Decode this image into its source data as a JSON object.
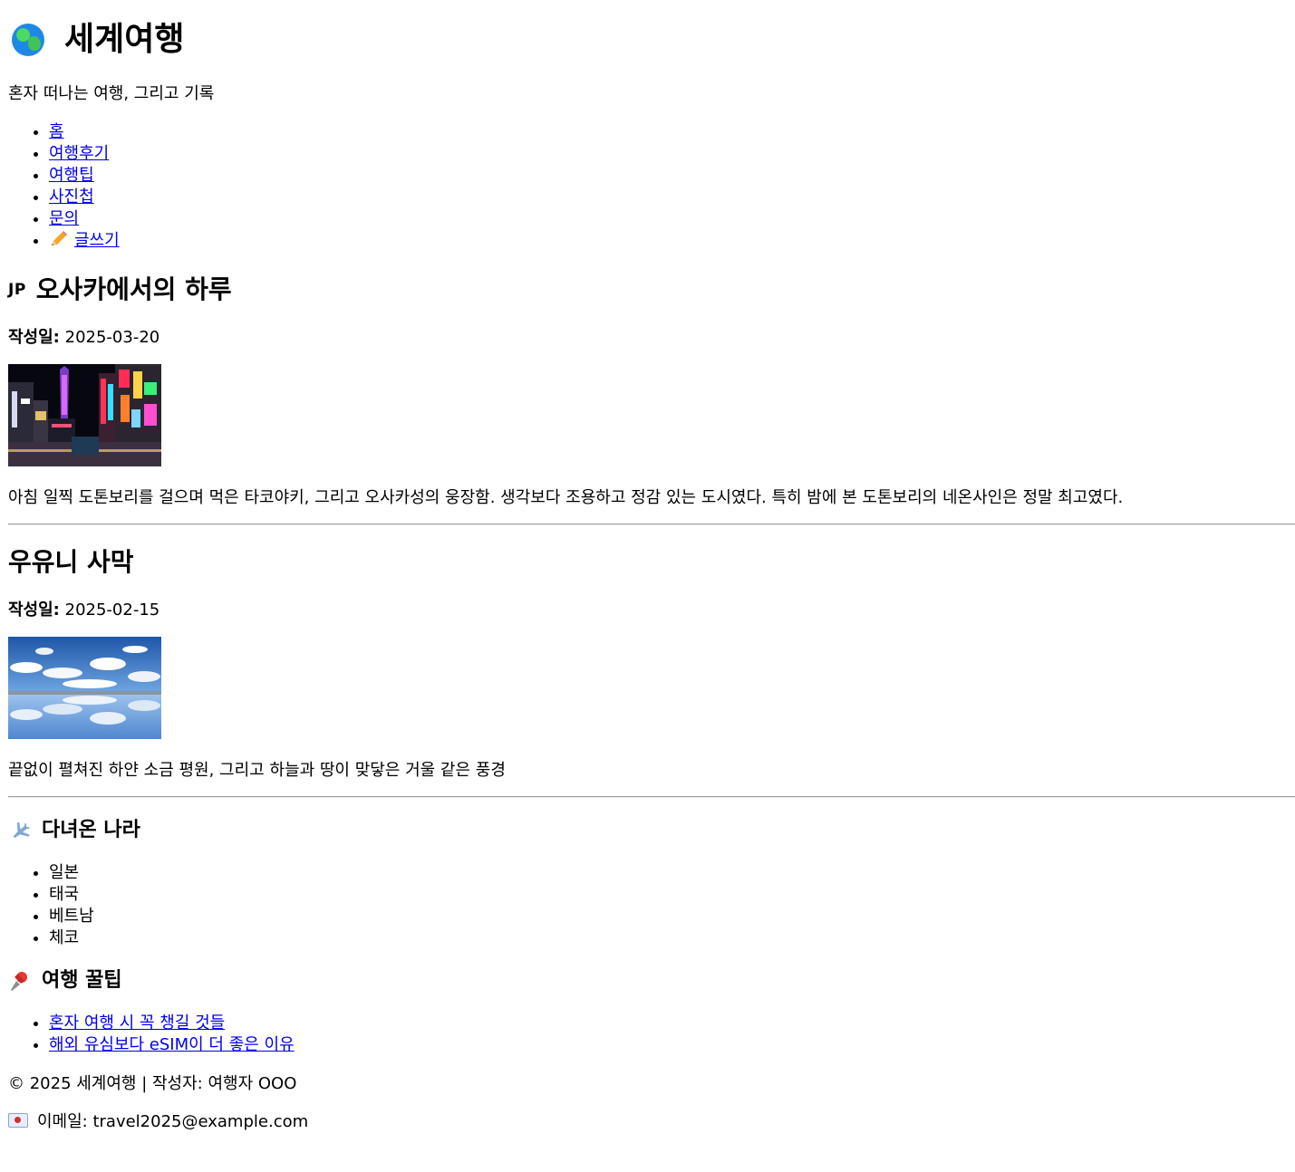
{
  "site": {
    "title": "세계여행",
    "tagline": "혼자 떠나는 여행, 그리고 기록"
  },
  "nav": {
    "items": [
      {
        "label": "홈"
      },
      {
        "label": "여행후기"
      },
      {
        "label": "여행팁"
      },
      {
        "label": "사진첩"
      },
      {
        "label": "문의"
      },
      {
        "label": "글쓰기",
        "icon": "pencil-icon"
      }
    ]
  },
  "posts": [
    {
      "flag": "JP",
      "title": "오사카에서의 하루",
      "date_label": "작성일:",
      "date": "2025-03-20",
      "summary": "아침 일찍 도톤보리를 걸으며 먹은 타코야키, 그리고 오사카성의 웅장함. 생각보다 조용하고 정감 있는 도시였다. 특히 밤에 본 도톤보리의 네온사인은 정말 최고였다."
    },
    {
      "title": "우유니 사막",
      "date_label": "작성일:",
      "date": "2025-02-15",
      "summary": "끝없이 펼쳐진 하얀 소금 평원, 그리고 하늘과 땅이 맞닿은 거울 같은 풍경"
    }
  ],
  "countries": {
    "icon": "airplane-icon",
    "heading": "다녀온 나라",
    "items": [
      "일본",
      "태국",
      "베트남",
      "체코"
    ]
  },
  "tips": {
    "icon": "pushpin-icon",
    "heading": "여행 꿀팁",
    "items": [
      "혼자 여행 시 꼭 챙길 것들",
      "해외 유심보다 eSIM이 더 좋은 이유"
    ]
  },
  "footer": {
    "copyright": "© 2025 세계여행 | 작성자: 여행자 OOO",
    "email_label": "이메일: travel2025@example.com"
  }
}
